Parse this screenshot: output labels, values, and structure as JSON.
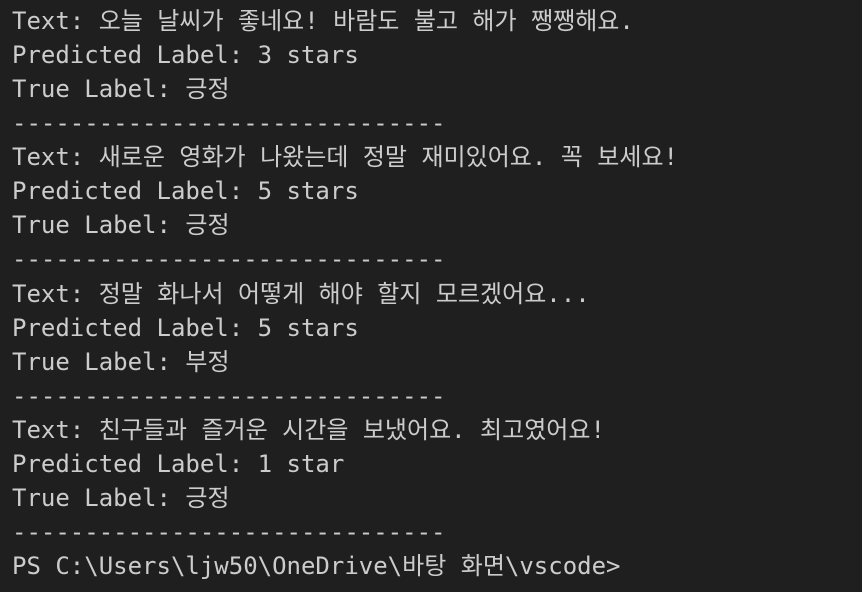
{
  "terminal": {
    "lines": [
      {
        "kind": "text",
        "text": "Text: 오늘 날씨가 좋네요! 바람도 불고 해가 쨍쨍해요."
      },
      {
        "kind": "predicted",
        "text": "Predicted Label: 3 stars"
      },
      {
        "kind": "true",
        "text": "True Label: 긍정"
      },
      {
        "kind": "divider",
        "text": "------------------------------"
      },
      {
        "kind": "text",
        "text": "Text: 새로운 영화가 나왔는데 정말 재미있어요. 꼭 보세요!"
      },
      {
        "kind": "predicted",
        "text": "Predicted Label: 5 stars"
      },
      {
        "kind": "true",
        "text": "True Label: 긍정"
      },
      {
        "kind": "divider",
        "text": "------------------------------"
      },
      {
        "kind": "text",
        "text": "Text: 정말 화나서 어떻게 해야 할지 모르겠어요..."
      },
      {
        "kind": "predicted",
        "text": "Predicted Label: 5 stars"
      },
      {
        "kind": "true",
        "text": "True Label: 부정"
      },
      {
        "kind": "divider",
        "text": "------------------------------"
      },
      {
        "kind": "text",
        "text": "Text: 친구들과 즐거운 시간을 보냈어요. 최고였어요!"
      },
      {
        "kind": "predicted",
        "text": "Predicted Label: 1 star"
      },
      {
        "kind": "true",
        "text": "True Label: 긍정"
      },
      {
        "kind": "divider",
        "text": "------------------------------"
      }
    ],
    "prompt": "PS C:\\Users\\ljw50\\OneDrive\\바탕 화면\\vscode>"
  },
  "colors": {
    "background": "#1f1f1f",
    "foreground": "#cccccc"
  }
}
